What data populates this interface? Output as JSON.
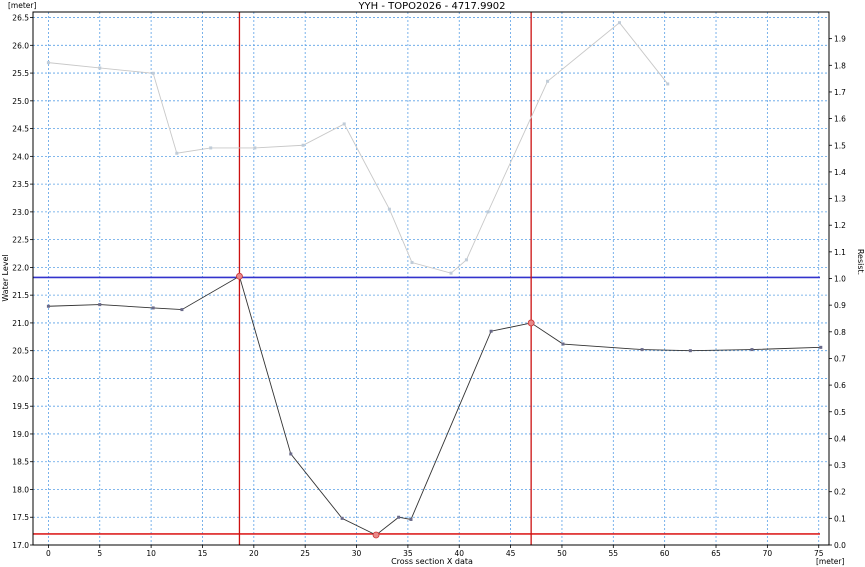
{
  "chart_data": {
    "type": "line",
    "title": "YYH - TOPO2026 - 4717.9902",
    "xlabel": "Cross section X data",
    "xunit": "[meter]",
    "ylabel": "Water Level",
    "yunit": "[meter]",
    "y2label": "Resist.",
    "xlim": [
      -1.5,
      76
    ],
    "ylim": [
      17.0,
      26.6
    ],
    "y2lim": [
      0.0,
      2.0
    ],
    "xticks": [
      "0",
      "5",
      "10",
      "15",
      "20",
      "25",
      "30",
      "35",
      "40",
      "45",
      "50",
      "55",
      "60",
      "65",
      "70",
      "75"
    ],
    "yticks": [
      "17.0",
      "17.5",
      "18.0",
      "18.5",
      "19.0",
      "19.5",
      "20.0",
      "20.5",
      "21.0",
      "21.5",
      "22.0",
      "22.5",
      "23.0",
      "23.5",
      "24.0",
      "24.5",
      "25.0",
      "25.5",
      "26.0",
      "26.5"
    ],
    "y2ticks": [
      "0.0",
      "0.1",
      "0.2",
      "0.3",
      "0.4",
      "0.5",
      "0.6",
      "0.7",
      "0.8",
      "0.9",
      "1.0",
      "1.1",
      "1.2",
      "1.3",
      "1.4",
      "1.5",
      "1.6",
      "1.7",
      "1.8",
      "1.9"
    ],
    "grid": true,
    "series": [
      {
        "axis": "left",
        "color": "#333333",
        "x": [
          0,
          5,
          10.2,
          13,
          18.6,
          23.6,
          28.6,
          31.9,
          34.1,
          35.3,
          43.1,
          47,
          50.1,
          57.8,
          62.5,
          68.5,
          75.2
        ],
        "y": [
          21.3,
          21.33,
          21.27,
          21.24,
          21.84,
          18.64,
          17.48,
          17.18,
          17.5,
          17.46,
          20.85,
          21.0,
          20.62,
          20.52,
          20.5,
          20.52,
          20.56
        ]
      },
      {
        "axis": "right",
        "color": "#c8c8c8",
        "x": [
          0,
          5,
          10.2,
          12.5,
          15.8,
          20.1,
          24.8,
          28.8,
          33.2,
          35.4,
          39.2,
          40.7,
          42.8,
          48.6,
          55.6,
          60.3
        ],
        "y": [
          1.81,
          1.79,
          1.77,
          1.47,
          1.49,
          1.49,
          1.5,
          1.58,
          1.26,
          1.06,
          1.02,
          1.07,
          1.25,
          1.74,
          1.96,
          1.73
        ]
      }
    ],
    "reference_lines": [
      {
        "orientation": "horizontal",
        "axis": "left",
        "value": 21.82,
        "color": "#3333cc"
      },
      {
        "orientation": "horizontal",
        "axis": "left",
        "value": 17.2,
        "color": "#dd2222"
      },
      {
        "orientation": "vertical",
        "value": 18.6,
        "color": "#cc1111"
      },
      {
        "orientation": "vertical",
        "value": 47,
        "color": "#cc1111"
      }
    ],
    "highlighted_points": [
      {
        "x": 18.6,
        "y": 21.84
      },
      {
        "x": 47,
        "y": 21.0
      },
      {
        "x": 31.9,
        "y": 17.18
      }
    ]
  }
}
